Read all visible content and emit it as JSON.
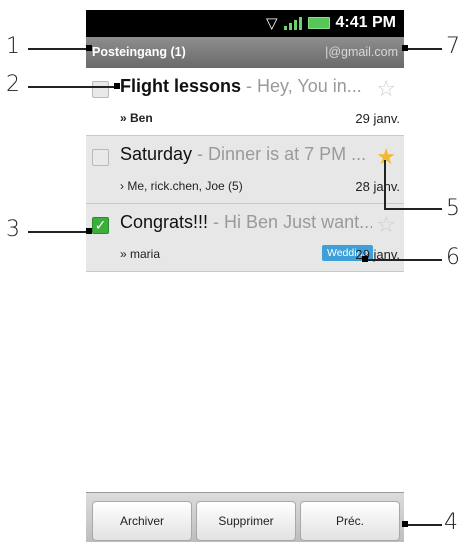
{
  "status_bar": {
    "time": "4:41 PM",
    "wifi_icon": "wifi-icon",
    "signal_icon": "signal-icon",
    "battery_icon": "battery-icon"
  },
  "header": {
    "title": "Posteingang (1)",
    "account": "|@gmail.com"
  },
  "messages": [
    {
      "subject": "Flight lessons",
      "snippet": " - Hey, You in...",
      "from": "» Ben",
      "date": "29 janv.",
      "starred": false,
      "checked": false,
      "unread": true,
      "label": ""
    },
    {
      "subject": "Saturday",
      "snippet": " - Dinner is at 7 PM ...",
      "from": "› Me, rick.chen, Joe (5)",
      "date": "28 janv.",
      "starred": true,
      "checked": false,
      "unread": false,
      "label": ""
    },
    {
      "subject": "Congrats!!!",
      "snippet": " - Hi Ben Just want...",
      "from": "» maria",
      "date": "29 janv.",
      "starred": false,
      "checked": true,
      "unread": false,
      "label": "Wedding"
    }
  ],
  "toolbar": {
    "archive": "Archiver",
    "delete": "Supprimer",
    "previous": "Préc."
  },
  "callouts": {
    "c1": "1",
    "c2": "2",
    "c3": "3",
    "c4": "4",
    "c5": "5",
    "c6": "6",
    "c7": "7"
  },
  "colors": {
    "star_on": "#f3b82e",
    "label_bg": "#3f9fd9",
    "checkbox_checked": "#3aaf3a"
  }
}
